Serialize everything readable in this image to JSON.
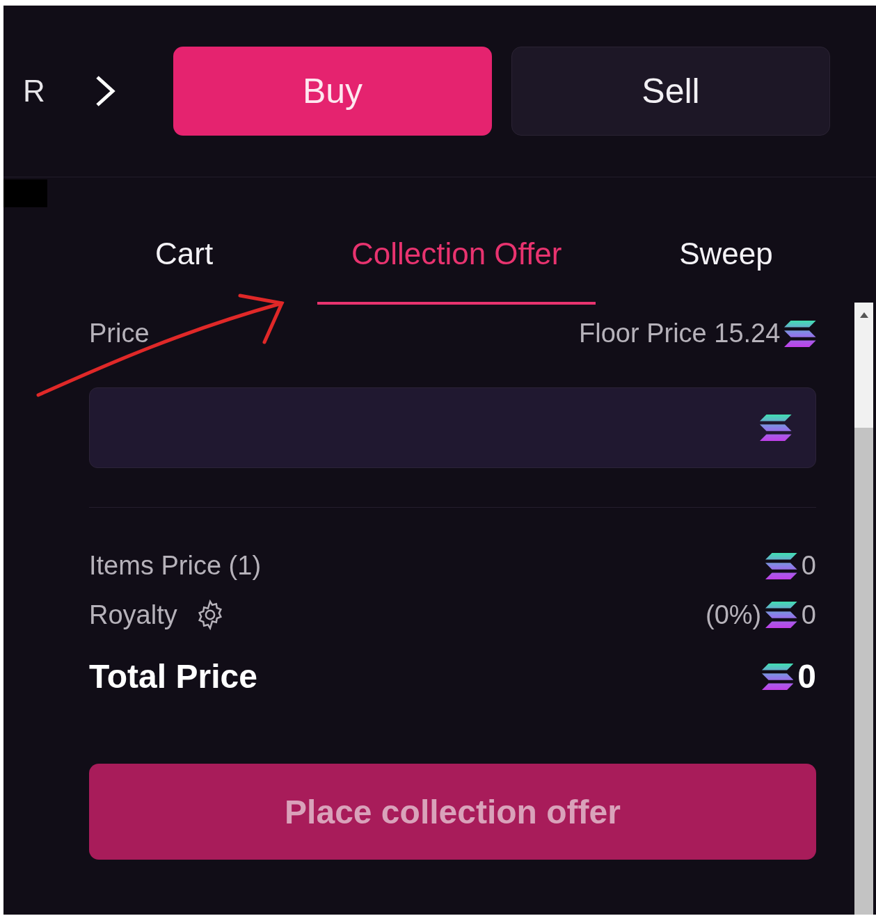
{
  "breadcrumb": {
    "label": "R"
  },
  "mode_buttons": [
    {
      "label": "Buy",
      "selected": true
    },
    {
      "label": "Sell",
      "selected": false
    }
  ],
  "tabs": [
    {
      "label": "Cart",
      "selected": false
    },
    {
      "label": "Collection Offer",
      "selected": true
    },
    {
      "label": "Sweep",
      "selected": false
    }
  ],
  "price": {
    "label": "Price",
    "floor_price": "Floor Price 15.24"
  },
  "summary": [
    {
      "label": "Items Price (1)",
      "value": "0",
      "kind": "plain"
    },
    {
      "label": "Royalty",
      "extra": "(0%)",
      "value": "0",
      "kind": "settings"
    }
  ],
  "total": {
    "label": "Total Price",
    "value": "0"
  },
  "submit": {
    "label": "Place collection offer",
    "disabled": true
  }
}
